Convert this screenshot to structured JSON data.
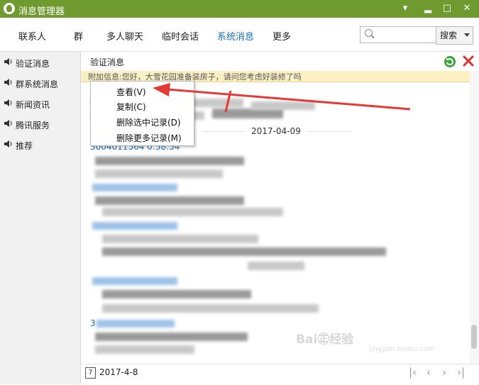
{
  "window": {
    "title": "消息管理器",
    "min_glyph": "▂",
    "max_glyph": "□",
    "close_glyph": "✕"
  },
  "nav": {
    "tabs": [
      "联系人",
      "群",
      "多人聊天",
      "临时会话",
      "系统消息",
      "更多"
    ],
    "active": "系统消息",
    "search_placeholder": "",
    "search_button": "搜索"
  },
  "sidebar": {
    "items": [
      "验证消息",
      "群系统消息",
      "新闻资讯",
      "腾讯服务",
      "推荐"
    ]
  },
  "content": {
    "title": "验证消息",
    "banner": "附加信息:您好，大雪花园准备装房子，请问您考虑好装修了吗",
    "date_separator": "2017-04-09",
    "id_line": "3004011564  0:58:54",
    "partial_num": "3",
    "footer_date": "2017-4-8",
    "calendar_day": "7"
  },
  "context_menu": {
    "items": [
      "查看(V)",
      "复制(C)",
      "删除选中记录(D)",
      "删除更多记录(M)"
    ]
  },
  "watermark": {
    "brand": "Bai㊣经验",
    "url": "jingyan.baidu.com"
  },
  "colors": {
    "titlebar": "#6e9a2f",
    "active_tab": "#1a6fb5",
    "banner": "#fbf0c4",
    "annotation_arrow": "#e53935"
  }
}
